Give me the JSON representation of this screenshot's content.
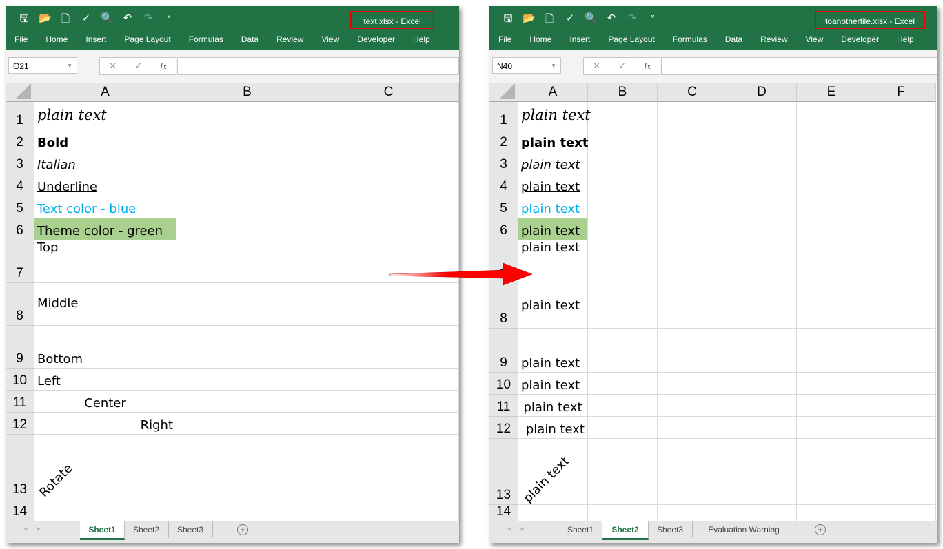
{
  "windows": [
    {
      "title": "text.xlsx  -  Excel",
      "namebox": "O21",
      "menu": [
        "File",
        "Home",
        "Insert",
        "Page Layout",
        "Formulas",
        "Data",
        "Review",
        "View",
        "Developer",
        "Help"
      ],
      "columns": [
        "A",
        "B",
        "C"
      ],
      "rows": [
        "1",
        "2",
        "3",
        "4",
        "5",
        "6",
        "7",
        "8",
        "9",
        "10",
        "11",
        "12",
        "13",
        "14"
      ],
      "cells": [
        "plain text",
        "Bold",
        "Italian",
        "Underline",
        "Text color - blue",
        "Theme color - green",
        "Top",
        "Middle",
        "Bottom",
        "Left",
        "Center",
        "Right",
        "Rotate",
        ""
      ],
      "sheets": [
        "Sheet1",
        "Sheet2",
        "Sheet3"
      ],
      "active_sheet": "Sheet1"
    },
    {
      "title": "toanotherfile.xlsx  -  Excel",
      "namebox": "N40",
      "menu": [
        "File",
        "Home",
        "Insert",
        "Page Layout",
        "Formulas",
        "Data",
        "Review",
        "View",
        "Developer",
        "Help"
      ],
      "columns": [
        "A",
        "B",
        "C",
        "D",
        "E",
        "F"
      ],
      "rows": [
        "1",
        "2",
        "3",
        "4",
        "5",
        "6",
        "7",
        "8",
        "9",
        "10",
        "11",
        "12",
        "13",
        "14"
      ],
      "cells": [
        "plain text",
        "plain text",
        "plain text",
        "plain text",
        "plain text",
        "plain text",
        "plain text",
        "plain text",
        "plain text",
        "plain text",
        "plain text",
        "plain text",
        "plain text",
        ""
      ],
      "sheets": [
        "Sheet1",
        "Sheet2",
        "Sheet3",
        "Evaluation Warning"
      ],
      "active_sheet": "Sheet2"
    }
  ],
  "colors": {
    "ribbon": "#217346",
    "blue_text": "#00b0f0",
    "green_fill": "#a9d08e",
    "arrow": "#ff0000"
  },
  "icons": [
    "save-icon",
    "open-icon",
    "new-icon",
    "spelling-icon",
    "print-preview-icon",
    "undo-icon",
    "redo-icon",
    "customize-icon"
  ]
}
